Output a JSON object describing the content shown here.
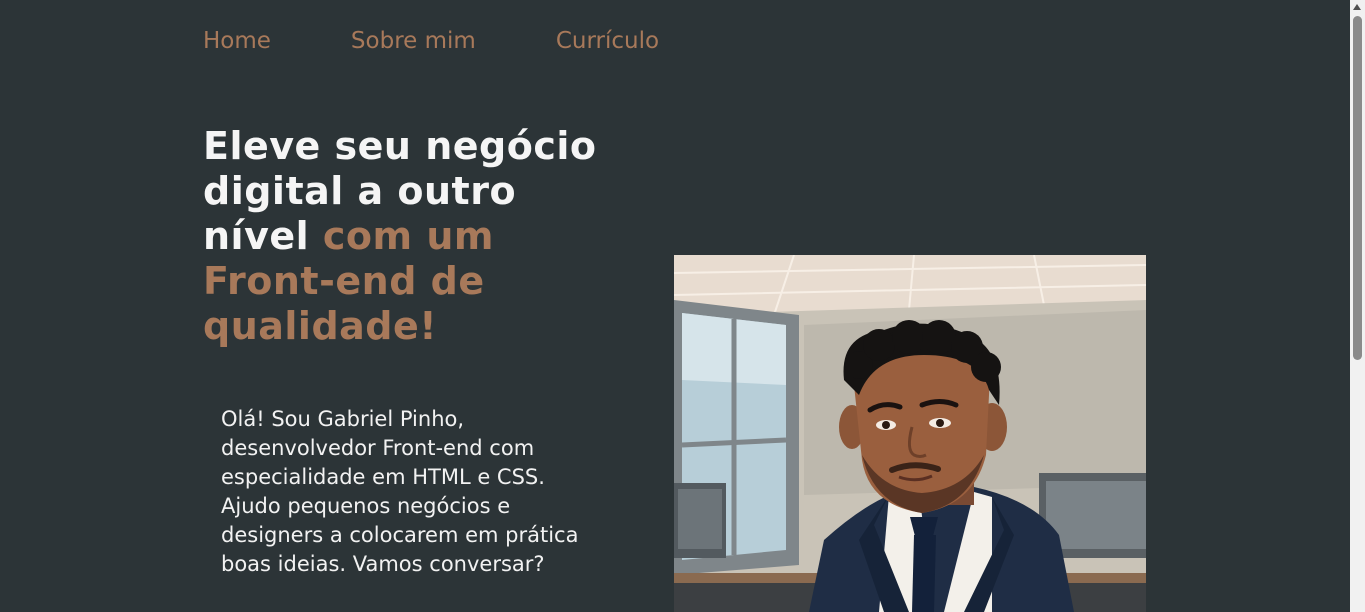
{
  "nav": {
    "items": [
      {
        "label": "Home"
      },
      {
        "label": "Sobre mim"
      },
      {
        "label": "Currículo"
      }
    ]
  },
  "hero": {
    "headline_main": "Eleve seu negócio digital a outro nível ",
    "headline_accent": "com um Front-end de qualidade!",
    "intro": "Olá! Sou Gabriel Pinho, desenvolvedor Front-end com especialidade em HTML e CSS. Ajudo pequenos negócios e designers a colocarem em prática boas ideias. Vamos conversar?"
  },
  "colors": {
    "background": "#2c3437",
    "accent": "#a8795a",
    "text": "#f5f5f5"
  }
}
